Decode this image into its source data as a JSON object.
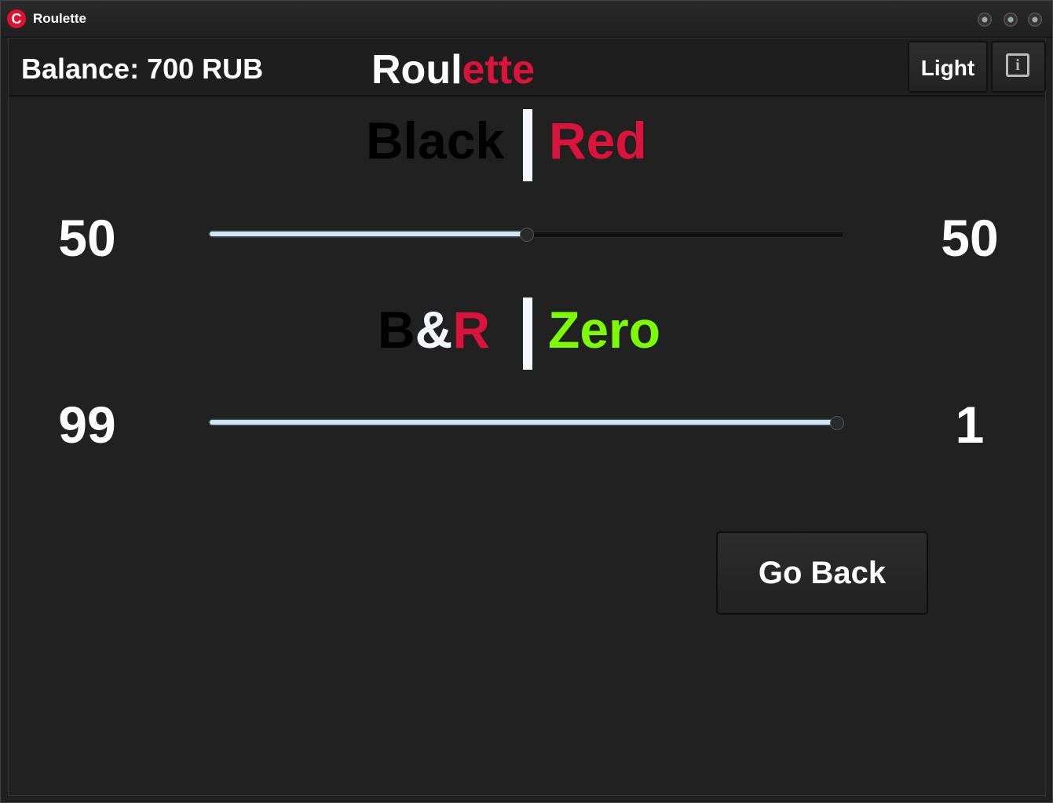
{
  "window": {
    "title": "Roulette",
    "icon_letter": "C",
    "icon_color": "#e01030"
  },
  "header": {
    "balance": "Balance: 700 RUB",
    "heading_part1": "Roul",
    "heading_part2": "ette",
    "theme_button": "Light",
    "info_button_glyph": "i"
  },
  "black_red": {
    "label_black": "Black",
    "label_red": "Red",
    "left_value": "50",
    "right_value": "50",
    "slider_fraction": 0.5
  },
  "br_zero": {
    "label_b": "B",
    "label_amp": "&",
    "label_r": "R",
    "label_zero": "Zero",
    "left_value": "99",
    "right_value": "1",
    "slider_fraction": 0.99
  },
  "actions": {
    "go_back": "Go Back"
  },
  "colors": {
    "red": "#dc143c",
    "green": "#7cfc00",
    "black": "#000000",
    "white": "#f3f7ff"
  }
}
